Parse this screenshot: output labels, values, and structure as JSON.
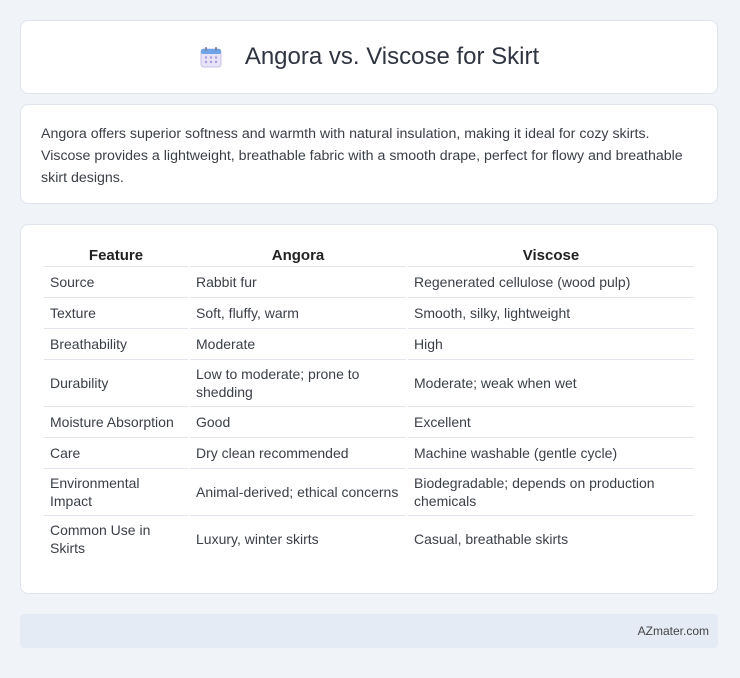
{
  "header": {
    "title": "Angora vs. Viscose for Skirt",
    "icon": "calendar-icon"
  },
  "summary": {
    "text": "Angora offers superior softness and warmth with natural insulation, making it ideal for cozy skirts. Viscose provides a lightweight, breathable fabric with a smooth drape, perfect for flowy and breathable skirt designs."
  },
  "table": {
    "headers": [
      "Feature",
      "Angora",
      "Viscose"
    ],
    "rows": [
      [
        "Source",
        "Rabbit fur",
        "Regenerated cellulose (wood pulp)"
      ],
      [
        "Texture",
        "Soft, fluffy, warm",
        "Smooth, silky, lightweight"
      ],
      [
        "Breathability",
        "Moderate",
        "High"
      ],
      [
        "Durability",
        "Low to moderate; prone to shedding",
        "Moderate; weak when wet"
      ],
      [
        "Moisture Absorption",
        "Good",
        "Excellent"
      ],
      [
        "Care",
        "Dry clean recommended",
        "Machine washable (gentle cycle)"
      ],
      [
        "Environmental Impact",
        "Animal-derived; ethical concerns",
        "Biodegradable; depends on production chemicals"
      ],
      [
        "Common Use in Skirts",
        "Luxury, winter skirts",
        "Casual, breathable skirts"
      ]
    ]
  },
  "footer": {
    "brand": "AZmater.com"
  }
}
